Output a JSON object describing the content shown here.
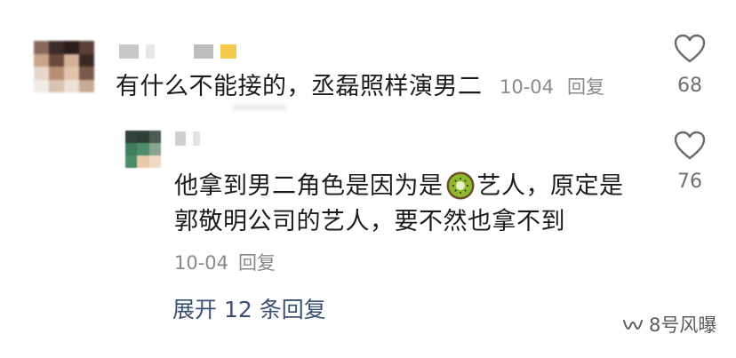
{
  "comments": [
    {
      "text": "有什么不能接的，丞磊照样演男二",
      "date": "10-04",
      "reply_label": "回复",
      "like_count": "68",
      "avatar_icon": "blurred-avatar",
      "like_icon": "heart-outline-icon"
    }
  ],
  "reply": {
    "text_before_emoji": "他拿到男二角色是因为是",
    "emoji": "kiwi-emoji",
    "text_after_emoji": "艺人，原定是",
    "line2": "郭敬明公司的艺人，要不然也拿不到",
    "date": "10-04",
    "reply_label": "回复",
    "like_count": "76",
    "avatar_icon": "blurred-avatar",
    "like_icon": "heart-outline-icon"
  },
  "expand_label": "展开 12 条回复",
  "watermark": {
    "icon": "wechat-channel-icon",
    "text": "8号风曝"
  },
  "colors": {
    "text": "#1b1b1b",
    "meta": "#8a8a8a",
    "link": "#3b4f73",
    "kiwi_skin": "#6b4e2a",
    "kiwi_flesh": "#8dbb2d"
  }
}
